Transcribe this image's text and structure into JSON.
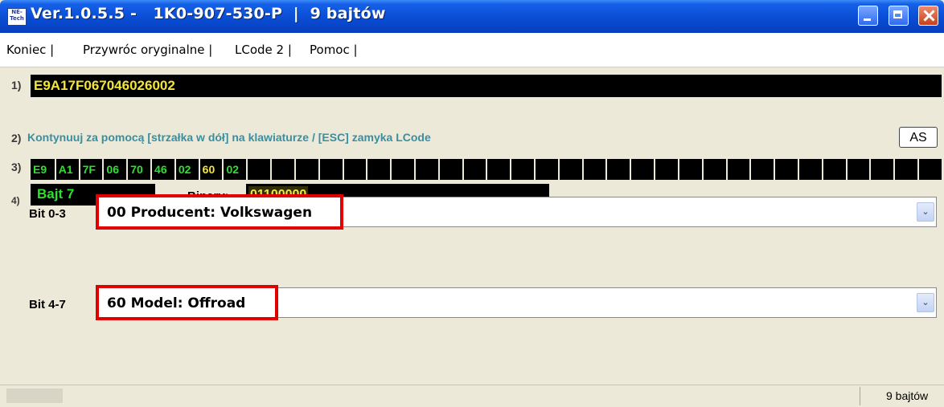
{
  "window": {
    "title": "Ver.1.0.5.5 -   1K0-907-530-P  |  9 bajtów",
    "icon_text": "NE-Tech"
  },
  "menu": [
    "Koniec |",
    "Przywróc oryginalne |",
    "LCode 2 |",
    "Pomoc |"
  ],
  "section1": {
    "label": "1)",
    "code": "E9A17F067046026002"
  },
  "section2": {
    "label": "2)",
    "instruction": "Kontynuuj za pomocą [strzałka w dół] na klawiaturze / [ESC] zamyka LCode",
    "as_button": "AS"
  },
  "section3": {
    "label": "3)",
    "bytes": [
      "E9",
      "A1",
      "7F",
      "06",
      "70",
      "46",
      "02",
      "60",
      "02",
      "",
      "",
      "",
      "",
      "",
      "",
      "",
      "",
      "",
      "",
      "",
      "",
      "",
      "",
      "",
      "",
      "",
      "",
      "",
      "",
      "",
      "",
      "",
      "",
      "",
      "",
      "",
      "",
      ""
    ],
    "byte_label": "Bajt 7",
    "binary_label": "Binary:",
    "binary_value": "01100000"
  },
  "section4": {
    "label": "4)",
    "rows": [
      {
        "label": "Bit 0-3",
        "value": "00 Producent: Volkswagen"
      },
      {
        "label": "Bit 4-7",
        "value": "60 Model: Offroad"
      }
    ]
  },
  "status": {
    "text": "9 bajtów"
  },
  "colors": {
    "title_bar": "#0a4fd6",
    "highlight": "#e00000",
    "green_text": "#30e030",
    "yellow_text": "#f4e53a"
  }
}
